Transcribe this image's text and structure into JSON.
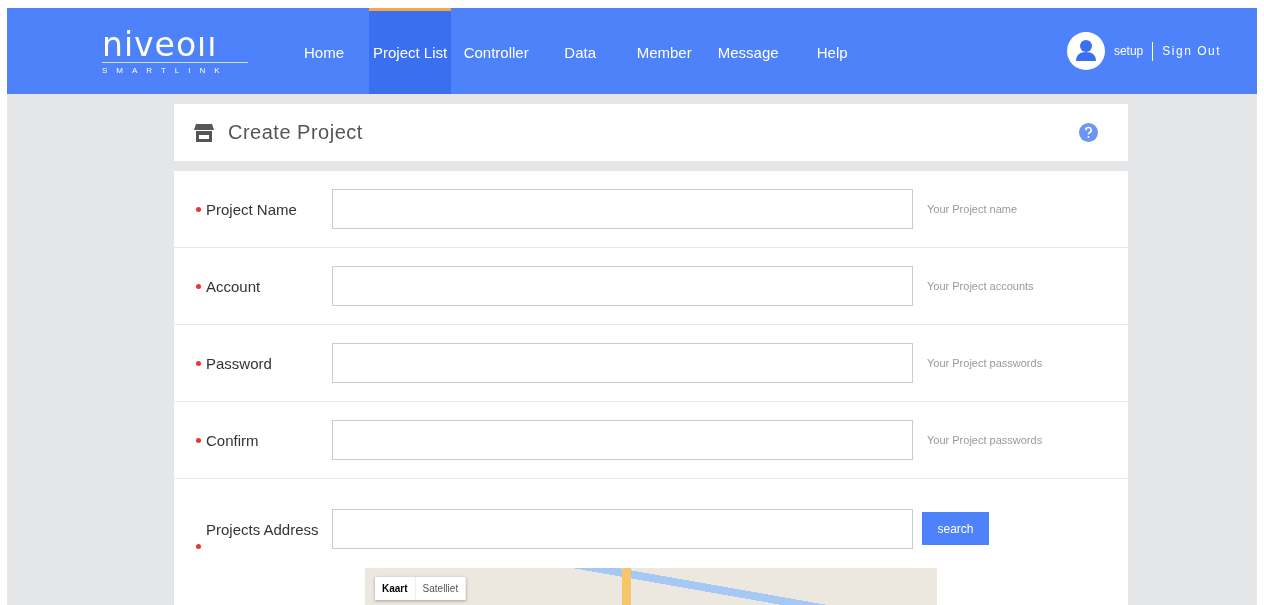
{
  "logo": {
    "wordmark": "niveoıı",
    "tagline": "SMARTLINK"
  },
  "nav": [
    {
      "label": "Home",
      "selected": false
    },
    {
      "label": "Project List",
      "selected": true
    },
    {
      "label": "Controller",
      "selected": false
    },
    {
      "label": "Data",
      "selected": false
    },
    {
      "label": "Member",
      "selected": false
    },
    {
      "label": "Message",
      "selected": false
    },
    {
      "label": "Help",
      "selected": false
    }
  ],
  "user": {
    "name": "setup",
    "sign_out": "Sign Out"
  },
  "page_title": "Create Project",
  "fields": [
    {
      "label": "Project Name",
      "required": true,
      "hint": "Your Project name"
    },
    {
      "label": "Account",
      "required": true,
      "hint": "Your Project accounts"
    },
    {
      "label": "Password",
      "required": true,
      "hint": "Your Project passwords"
    },
    {
      "label": "Confirm",
      "required": true,
      "hint": "Your Project passwords"
    }
  ],
  "address": {
    "label": "Projects Address",
    "required": true,
    "button": "search"
  },
  "map_types": [
    {
      "label": "Kaart",
      "selected": true
    },
    {
      "label": "Satelliet",
      "selected": false
    }
  ]
}
